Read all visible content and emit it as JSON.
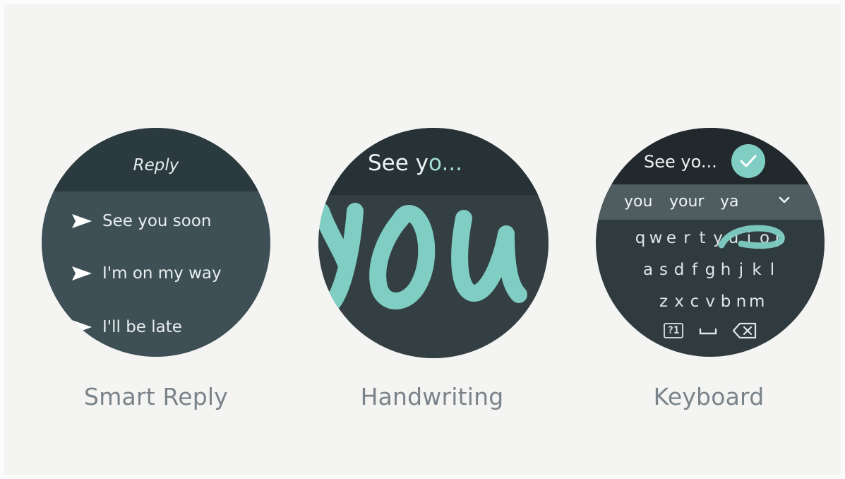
{
  "panels": [
    {
      "caption": "Smart Reply",
      "header_title": "Reply",
      "replies": [
        "See you soon",
        "I'm on my way",
        "I'll be late"
      ],
      "icon": "send-icon"
    },
    {
      "caption": "Handwriting",
      "typed_prefix": "See y",
      "typed_suffix": "o...",
      "ink_text": "you"
    },
    {
      "caption": "Keyboard",
      "typed_text": "See yo...",
      "suggestions": [
        "you",
        "your",
        "ya"
      ],
      "rows": [
        [
          "q",
          "w",
          "e",
          "r",
          "t",
          "y",
          "u",
          "i",
          "o",
          "p"
        ],
        [
          "a",
          "s",
          "d",
          "f",
          "g",
          "h",
          "j",
          "k",
          "l"
        ],
        [
          "z",
          "x",
          "c",
          "v",
          "b",
          "n",
          "m"
        ]
      ],
      "symbol_key": "?1",
      "icons": [
        "check-icon",
        "chevron-down-icon",
        "space-icon",
        "backspace-icon"
      ]
    }
  ],
  "colors": {
    "accent": "#7fcdc3",
    "page_bg": "#f4f4f3",
    "caption": "#7a8389"
  }
}
